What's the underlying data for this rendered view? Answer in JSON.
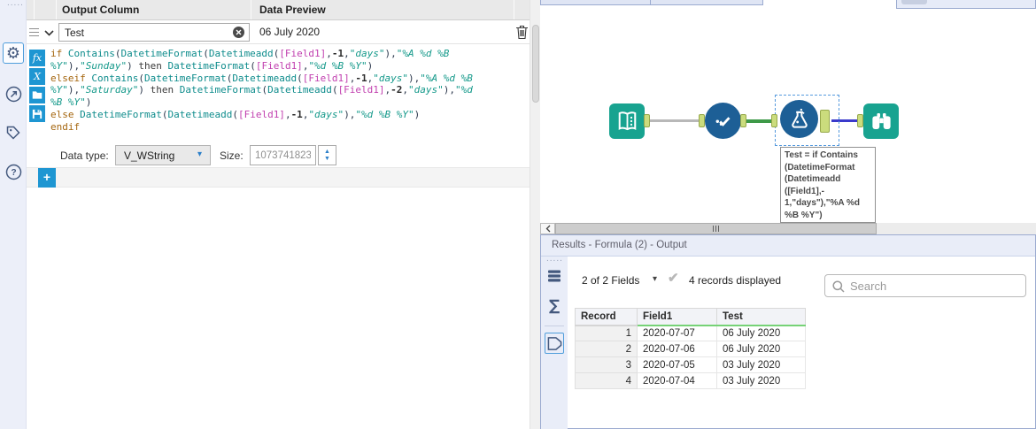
{
  "left_toolbar": {
    "items": [
      {
        "name": "configuration",
        "icon": "gear-icon",
        "selected": true
      },
      {
        "name": "navigation",
        "icon": "arrow-circle-icon",
        "selected": false
      },
      {
        "name": "annotation",
        "icon": "tag-icon",
        "selected": false
      },
      {
        "name": "help",
        "icon": "help-icon",
        "selected": false
      }
    ]
  },
  "config_panel": {
    "columns": {
      "output_column": "Output Column",
      "data_preview": "Data Preview"
    },
    "expression_row": {
      "name_value": "Test",
      "preview_value": "06 July 2020"
    },
    "editor_toolbar": [
      {
        "name": "functions",
        "label": "fx"
      },
      {
        "name": "variables",
        "label": "X"
      },
      {
        "name": "open",
        "icon": "folder-icon"
      },
      {
        "name": "save",
        "icon": "save-icon"
      }
    ],
    "code_lines": [
      [
        [
          "kw",
          "if "
        ],
        [
          "fn",
          "Contains"
        ],
        [
          "pu",
          "("
        ],
        [
          "fn",
          "DatetimeFormat"
        ],
        [
          "pu",
          "("
        ],
        [
          "fn",
          "Datetimeadd"
        ],
        [
          "pu",
          "("
        ],
        [
          "fl",
          "[Field1]"
        ],
        [
          "pu",
          ","
        ],
        [
          "nu",
          "-1"
        ],
        [
          "pu",
          ","
        ],
        [
          "st",
          "\"days\""
        ],
        [
          "pu",
          "),"
        ],
        [
          "st",
          "\"%A %d %B"
        ]
      ],
      [
        [
          "st",
          "%Y\""
        ],
        [
          "pu",
          "),"
        ],
        [
          "st",
          "\"Sunday\""
        ],
        [
          "pu",
          ") "
        ],
        [
          "tx",
          "then "
        ],
        [
          "fn",
          "DatetimeFormat"
        ],
        [
          "pu",
          "("
        ],
        [
          "fl",
          "[Field1]"
        ],
        [
          "pu",
          ","
        ],
        [
          "st",
          "\"%d %B %Y\""
        ],
        [
          "pu",
          ")"
        ]
      ],
      [
        [
          "kw",
          "elseif "
        ],
        [
          "fn",
          "Contains"
        ],
        [
          "pu",
          "("
        ],
        [
          "fn",
          "DatetimeFormat"
        ],
        [
          "pu",
          "("
        ],
        [
          "fn",
          "Datetimeadd"
        ],
        [
          "pu",
          "("
        ],
        [
          "fl",
          "[Field1]"
        ],
        [
          "pu",
          ","
        ],
        [
          "nu",
          "-1"
        ],
        [
          "pu",
          ","
        ],
        [
          "st",
          "\"days\""
        ],
        [
          "pu",
          "),"
        ],
        [
          "st",
          "\"%A %d %B"
        ]
      ],
      [
        [
          "st",
          "%Y\""
        ],
        [
          "pu",
          "),"
        ],
        [
          "st",
          "\"Saturday\""
        ],
        [
          "pu",
          ") "
        ],
        [
          "tx",
          "then "
        ],
        [
          "fn",
          "DatetimeFormat"
        ],
        [
          "pu",
          "("
        ],
        [
          "fn",
          "Datetimeadd"
        ],
        [
          "pu",
          "("
        ],
        [
          "fl",
          "[Field1]"
        ],
        [
          "pu",
          ","
        ],
        [
          "nu",
          "-2"
        ],
        [
          "pu",
          ","
        ],
        [
          "st",
          "\"days\""
        ],
        [
          "pu",
          "),"
        ],
        [
          "st",
          "\"%d"
        ]
      ],
      [
        [
          "st",
          "%B %Y\""
        ],
        [
          "pu",
          ")"
        ]
      ],
      [
        [
          "kw",
          "else "
        ],
        [
          "fn",
          "DatetimeFormat"
        ],
        [
          "pu",
          "("
        ],
        [
          "fn",
          "Datetimeadd"
        ],
        [
          "pu",
          "("
        ],
        [
          "fl",
          "[Field1]"
        ],
        [
          "pu",
          ","
        ],
        [
          "nu",
          "-1"
        ],
        [
          "pu",
          ","
        ],
        [
          "st",
          "\"days\""
        ],
        [
          "pu",
          "),"
        ],
        [
          "st",
          "\"%d %B %Y\""
        ],
        [
          "pu",
          ")"
        ]
      ],
      [
        [
          "kw",
          "endif"
        ]
      ]
    ],
    "data_type_label": "Data type:",
    "data_type_value": "V_WString",
    "size_label": "Size:",
    "size_value": "1073741823",
    "add_button": "+"
  },
  "canvas": {
    "tools": [
      {
        "name": "Text Input",
        "icon": "book-icon",
        "color": "#18A390"
      },
      {
        "name": "Select",
        "icon": "check-icon",
        "color": "#1D5F96"
      },
      {
        "name": "Formula",
        "icon": "flask-icon",
        "color": "#1D5F96",
        "selected": true
      },
      {
        "name": "Browse",
        "icon": "binoculars-icon",
        "color": "#18A390"
      }
    ],
    "annotation_lines": [
      "Test = if Contains",
      "(DatetimeFormat",
      "(Datetimeadd",
      "([Field1],-",
      "1,\"days\"),\"%A %d",
      "%B %Y\")"
    ]
  },
  "results": {
    "title": "Results - Formula (2) - Output",
    "fields_summary": "2 of 2 Fields",
    "records_summary": "4 records displayed",
    "search_placeholder": "Search",
    "table": {
      "columns": [
        "Record",
        "Field1",
        "Test"
      ],
      "rows": [
        [
          "1",
          "2020-07-07",
          "06 July 2020"
        ],
        [
          "2",
          "2020-07-06",
          "06 July 2020"
        ],
        [
          "3",
          "2020-07-05",
          "03 July 2020"
        ],
        [
          "4",
          "2020-07-04",
          "03 July 2020"
        ]
      ]
    }
  },
  "colors": {
    "accent_blue": "#1E96D2",
    "teal_tool": "#18A390",
    "blue_tool": "#1D5F96",
    "wire_gray": "#B8B8B8",
    "wire_green": "#3E9948",
    "wire_blue": "#3A3ACB",
    "anchor_green": "#CBDC7D",
    "rail_bg": "#ECEFF9",
    "type_underline_green": "#76D276",
    "syntax": {
      "keyword": "#A5660F",
      "function": "#0E8C8C",
      "string": "#14998A",
      "field": "#C13FAF",
      "number": "#2B2B2B",
      "punct": "#2E3A4E"
    }
  }
}
